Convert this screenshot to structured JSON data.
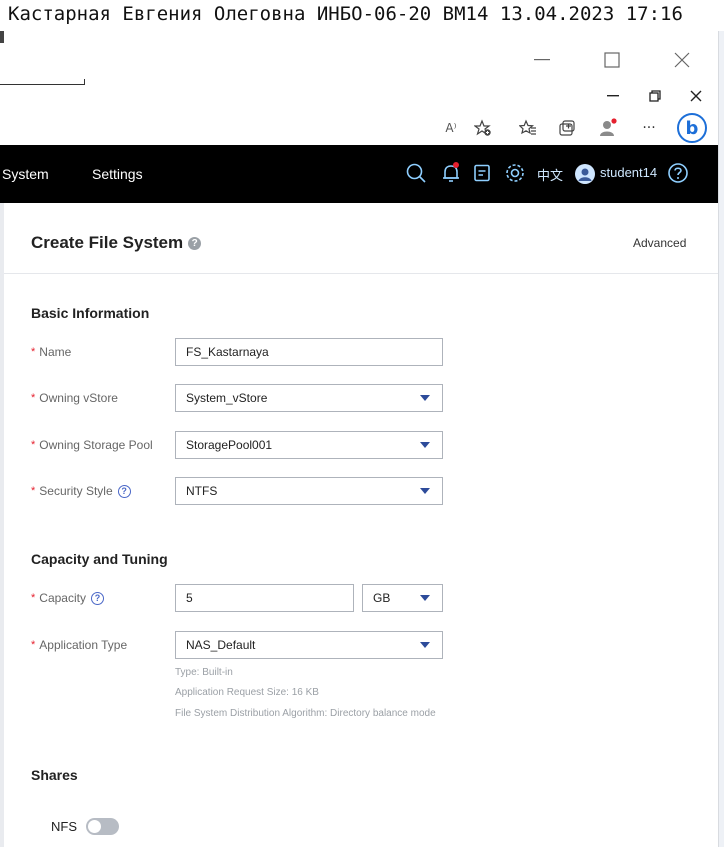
{
  "caption": "Кастарная Евгения Олеговна ИНБО-06-20 ВМ14 13.04.2023 17:16",
  "browser": {
    "window_controls": [
      "—",
      "☐",
      "✕"
    ],
    "tab_controls": [
      "—",
      "⧉",
      "✕"
    ],
    "toolbar_icons": [
      "read-aloud",
      "add-favorite",
      "favorites",
      "collections",
      "profile",
      "more",
      "bing"
    ],
    "more_label": "···",
    "readaloud_label": "A⁾",
    "bing_label": "b"
  },
  "topnav": {
    "items": [
      "System",
      "Settings"
    ],
    "lang": "中文",
    "user": "student14",
    "icons": [
      "search-icon",
      "bell-icon",
      "task-icon",
      "gear-icon",
      "help-icon"
    ]
  },
  "dialog": {
    "title": "Create File System",
    "advanced": "Advanced",
    "sections": {
      "basic": "Basic Information",
      "capacity": "Capacity and Tuning",
      "shares": "Shares"
    },
    "fields": {
      "name": {
        "label": "Name",
        "value": "FS_Kastarnaya"
      },
      "vstore": {
        "label": "Owning vStore",
        "value": "System_vStore"
      },
      "pool": {
        "label": "Owning Storage Pool",
        "value": "StoragePool001"
      },
      "security": {
        "label": "Security Style",
        "value": "NTFS"
      },
      "capacity": {
        "label": "Capacity",
        "value": "5",
        "unit": "GB"
      },
      "apptype": {
        "label": "Application Type",
        "value": "NAS_Default"
      }
    },
    "hints": [
      "Type: Built-in",
      "Application Request Size: 16 KB",
      "File System Distribution Algorithm: Directory balance mode"
    ],
    "shares": {
      "nfs_label": "NFS",
      "nfs_enabled": false
    },
    "required_mark": "*"
  }
}
